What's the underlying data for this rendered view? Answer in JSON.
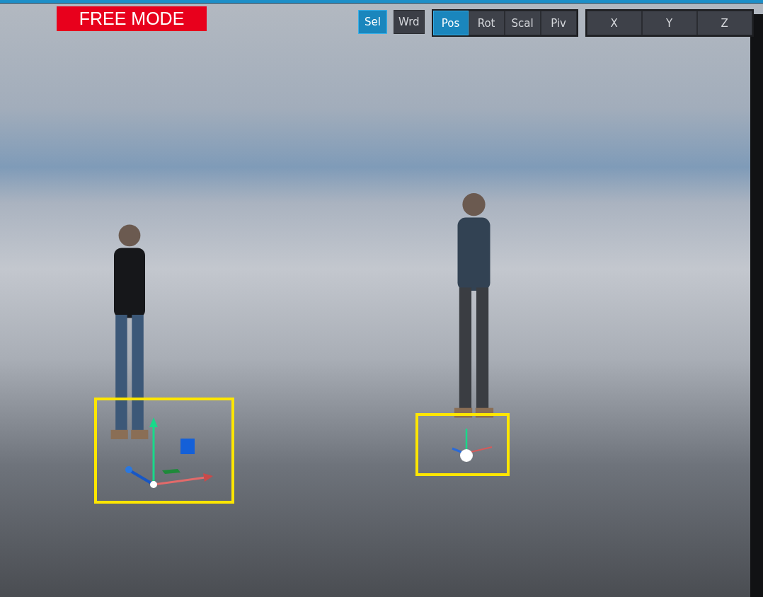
{
  "mode_banner": "FREE MODE",
  "space_buttons": [
    {
      "label": "Sel",
      "selected": true
    },
    {
      "label": "Wrd",
      "selected": false
    }
  ],
  "transform_tabs": [
    {
      "label": "Pos",
      "selected": true
    },
    {
      "label": "Rot",
      "selected": false
    },
    {
      "label": "Scal",
      "selected": false
    },
    {
      "label": "Piv",
      "selected": false
    }
  ],
  "axis_buttons": [
    {
      "label": "X",
      "selected": false
    },
    {
      "label": "Y",
      "selected": false
    },
    {
      "label": "Z",
      "selected": false
    }
  ],
  "selections": [
    {
      "kind": "full"
    },
    {
      "kind": "pivot"
    }
  ]
}
